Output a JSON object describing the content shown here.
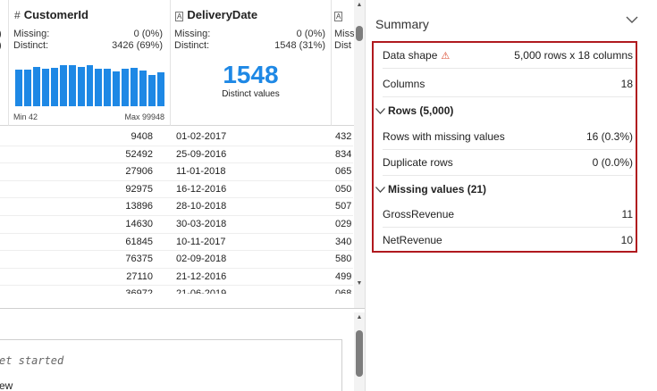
{
  "columns": [
    {
      "name": "CustomerId",
      "type_icon": "#",
      "missing_label": "Missing:",
      "missing_value": "0 (0%)",
      "distinct_label": "Distinct:",
      "distinct_value": "3426 (69%)",
      "min_label": "Min 42",
      "max_label": "Max 99948",
      "histogram": [
        0.88,
        0.88,
        0.93,
        0.9,
        0.92,
        0.97,
        0.97,
        0.93,
        0.97,
        0.9,
        0.9,
        0.82,
        0.9,
        0.92,
        0.85,
        0.75,
        0.8
      ]
    },
    {
      "name": "DeliveryDate",
      "type_icon": "A",
      "missing_label": "Missing:",
      "missing_value": "0 (0%)",
      "distinct_label": "Distinct:",
      "distinct_value": "1548 (31%)",
      "big_number": "1548",
      "big_caption": "Distinct values"
    },
    {
      "type_icon": "A",
      "missing_label": "Miss",
      "distinct_label": "Dist"
    }
  ],
  "rows": [
    {
      "id": "9408",
      "date": "01-02-2017",
      "c3": "432"
    },
    {
      "id": "52492",
      "date": "25-09-2016",
      "c3": "834"
    },
    {
      "id": "27906",
      "date": "11-01-2018",
      "c3": "065"
    },
    {
      "id": "92975",
      "date": "16-12-2016",
      "c3": "050"
    },
    {
      "id": "13896",
      "date": "28-10-2018",
      "c3": "507"
    },
    {
      "id": "14630",
      "date": "30-03-2018",
      "c3": "029"
    },
    {
      "id": "61845",
      "date": "10-11-2017",
      "c3": "340"
    },
    {
      "id": "76375",
      "date": "02-09-2018",
      "c3": "580"
    },
    {
      "id": "27110",
      "date": "21-12-2016",
      "c3": "499"
    },
    {
      "id": "36972",
      "date": "21-06-2019",
      "c3": "068"
    }
  ],
  "console": {
    "line1": "et started",
    "line2": "ew"
  },
  "summary": {
    "title": "Summary",
    "data_shape_label": "Data shape",
    "data_shape_value": "5,000 rows x 18 columns",
    "columns_label": "Columns",
    "columns_value": "18",
    "rows_section": "Rows (5,000)",
    "missing_rows_label": "Rows with missing values",
    "missing_rows_value": "16 (0.3%)",
    "dup_rows_label": "Duplicate rows",
    "dup_rows_value": "0 (0.0%)",
    "missing_section": "Missing values (21)",
    "gross_label": "GrossRevenue",
    "gross_value": "11",
    "net_label": "NetRevenue",
    "net_value": "10"
  },
  "colors": {
    "accent": "#1e88e5",
    "highlight_border": "#b0191e",
    "warning": "#d9472b"
  }
}
